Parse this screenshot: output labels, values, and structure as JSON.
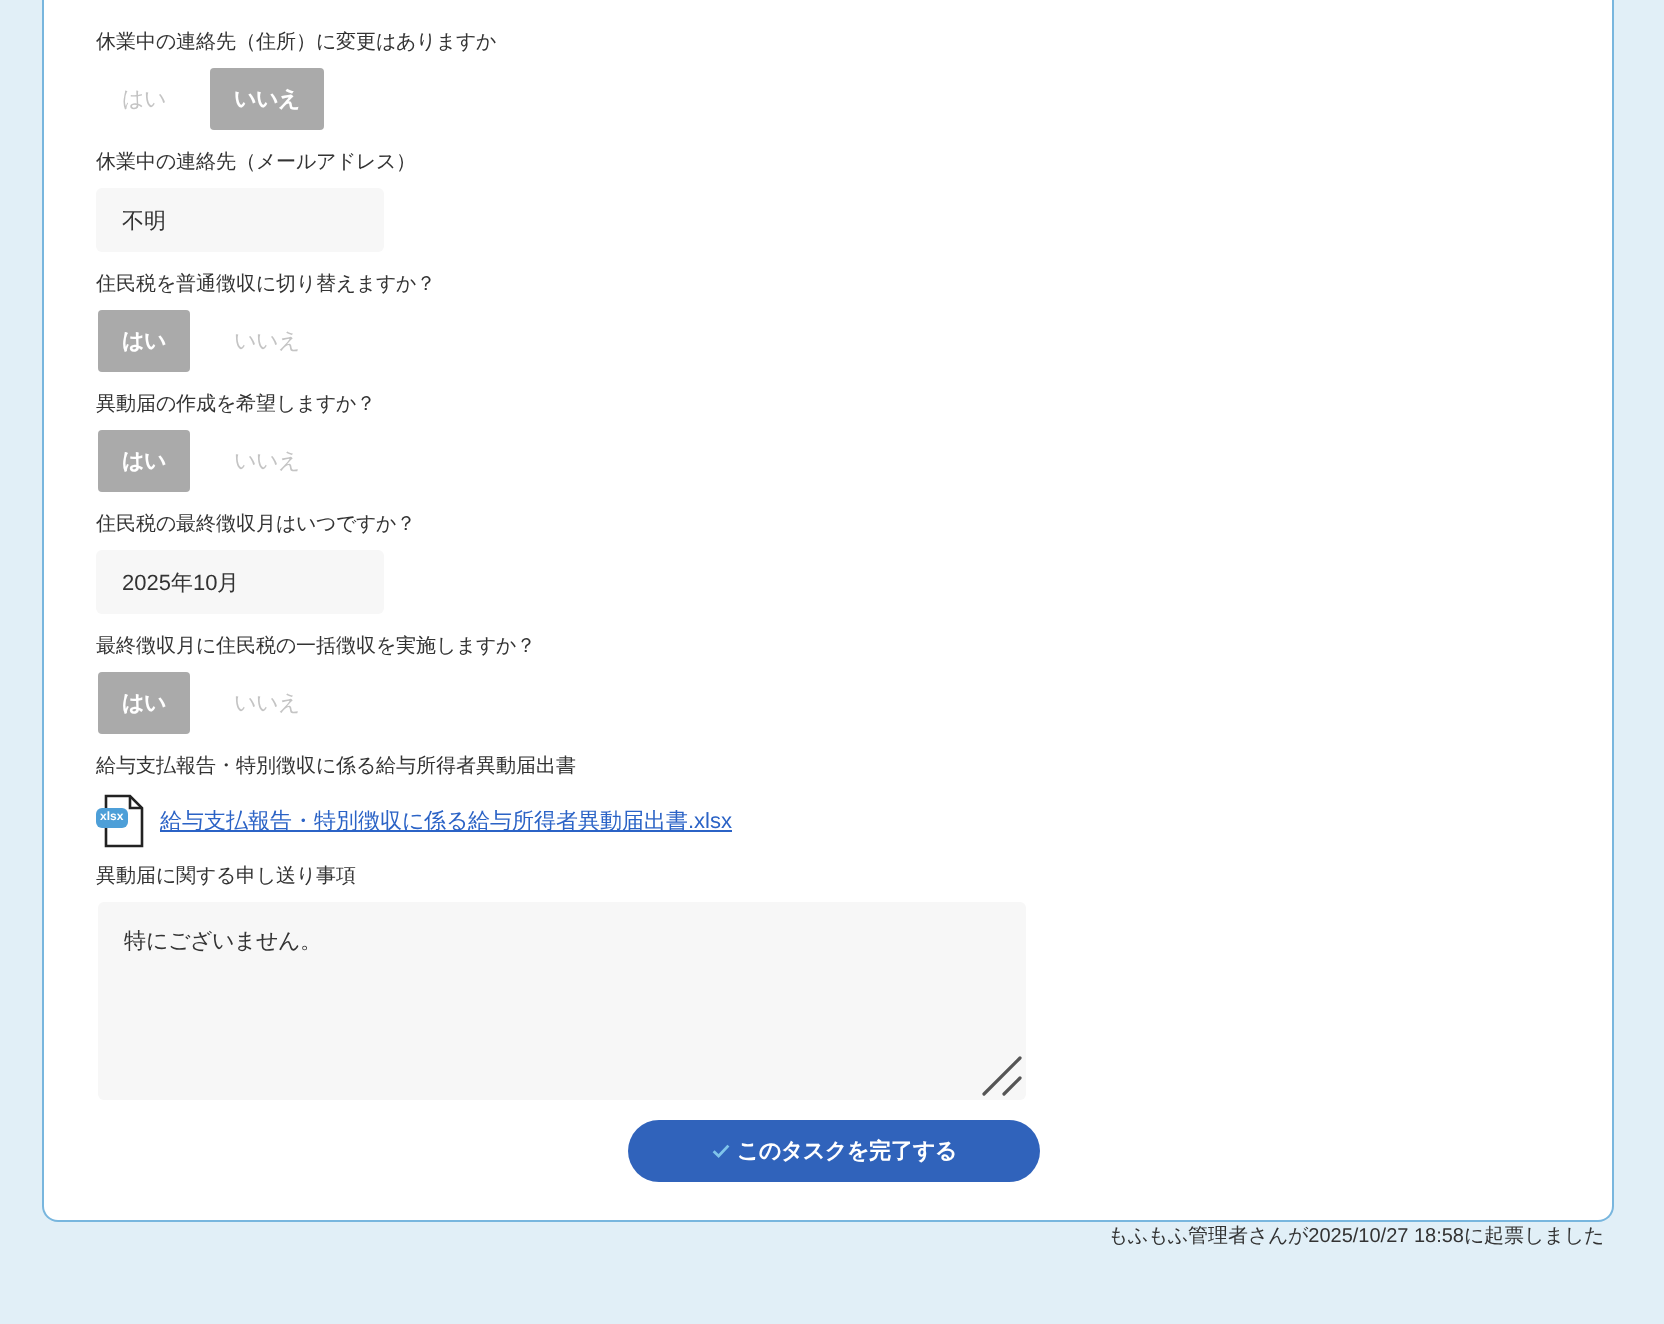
{
  "questions": [
    {
      "kind": "choice",
      "label": "休業中の連絡先（住所）に変更はありますか",
      "options": [
        {
          "label": "はい",
          "selected": false
        },
        {
          "label": "いいえ",
          "selected": true
        }
      ]
    },
    {
      "kind": "text",
      "label": "休業中の連絡先（メールアドレス）",
      "value": "不明"
    },
    {
      "kind": "choice",
      "label": "住民税を普通徴収に切り替えますか？",
      "options": [
        {
          "label": "はい",
          "selected": true
        },
        {
          "label": "いいえ",
          "selected": false
        }
      ]
    },
    {
      "kind": "choice",
      "label": "異動届の作成を希望しますか？",
      "options": [
        {
          "label": "はい",
          "selected": true
        },
        {
          "label": "いいえ",
          "selected": false
        }
      ]
    },
    {
      "kind": "text",
      "label": "住民税の最終徴収月はいつですか？",
      "value": "2025年10月"
    },
    {
      "kind": "choice",
      "label": "最終徴収月に住民税の一括徴収を実施しますか？",
      "options": [
        {
          "label": "はい",
          "selected": true
        },
        {
          "label": "いいえ",
          "selected": false
        }
      ]
    },
    {
      "kind": "file",
      "label": "給与支払報告・特別徴収に係る給与所得者異動届出書",
      "file_type": "xlsx",
      "file_name": "給与支払報告・特別徴収に係る給与所得者異動届出書.xlsx"
    },
    {
      "kind": "textarea",
      "label": "異動届に関する申し送り事項",
      "value": "特にございません。"
    }
  ],
  "complete_button": {
    "label": "このタスクを完了する"
  },
  "footer": "もふもふ管理者さんが2025/10/27 18:58に起票しました"
}
